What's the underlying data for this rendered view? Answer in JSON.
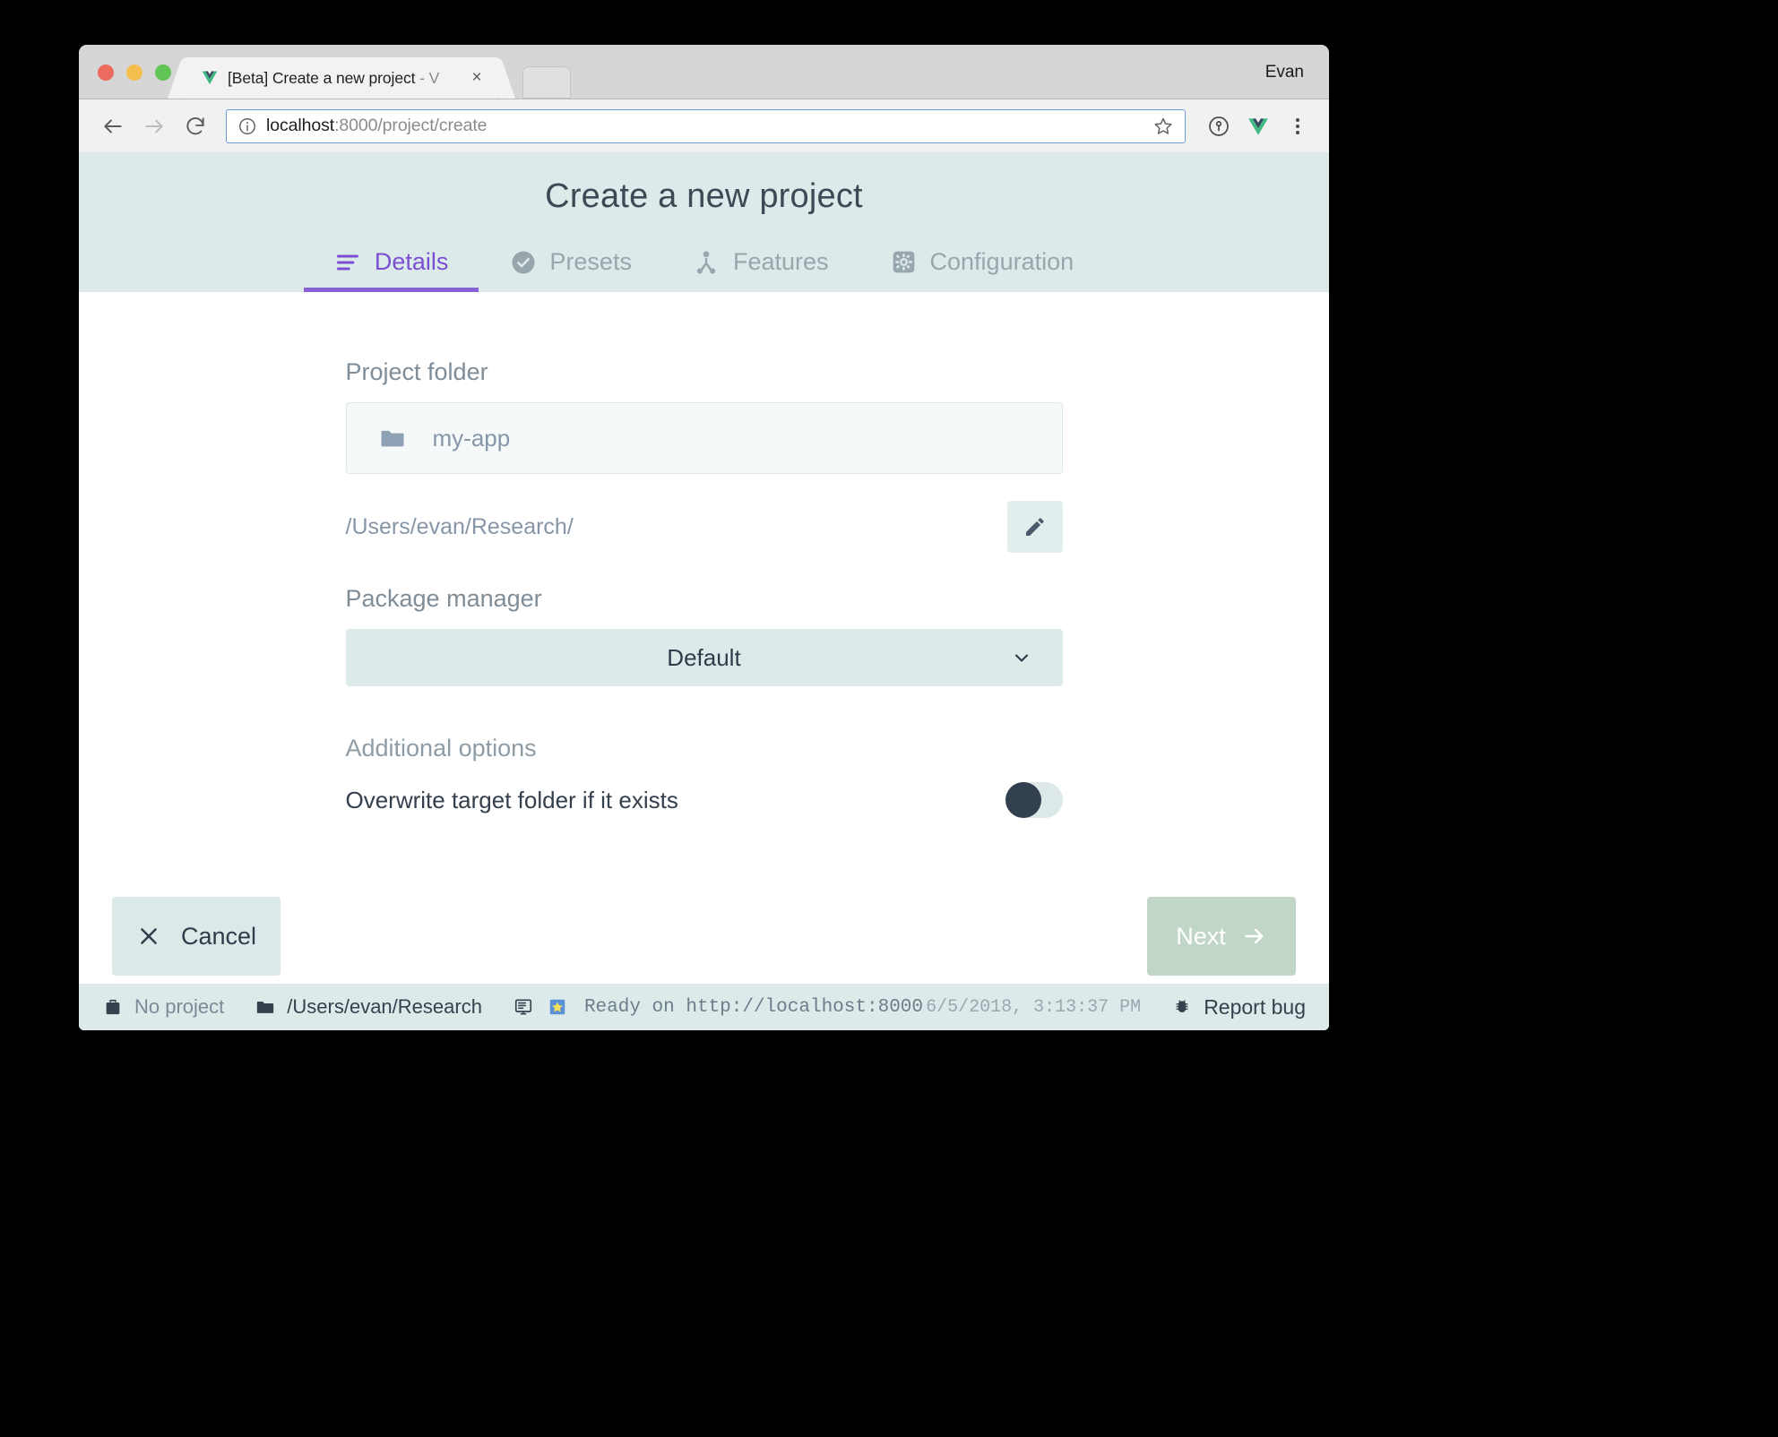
{
  "browser": {
    "tab": {
      "title_main": "[Beta] Create a new project",
      "title_dim": " - V",
      "close_label": "×",
      "favicon_name": "vue-logo-icon"
    },
    "new_tab_label": "",
    "profile_name": "Evan",
    "toolbar": {
      "back_label": "←",
      "forward_label": "→",
      "reload_label": "↻",
      "url_host": "localhost",
      "url_rest": ":8000/project/create",
      "url_full": "localhost:8000/project/create",
      "bookmark_label": "☆",
      "menu_label": "⋮"
    }
  },
  "app": {
    "title": "Create a new project",
    "tabs": [
      {
        "label": "Details",
        "icon": "list-icon",
        "active": true
      },
      {
        "label": "Presets",
        "icon": "check-circle-icon",
        "active": false
      },
      {
        "label": "Features",
        "icon": "sitemap-icon",
        "active": false
      },
      {
        "label": "Configuration",
        "icon": "cog-box-icon",
        "active": false
      }
    ],
    "form": {
      "project_folder_label": "Project folder",
      "project_folder_value": "my-app",
      "project_folder_icon": "folder-icon",
      "path_value": "/Users/evan/Research/",
      "edit_button_icon": "pencil-icon",
      "package_manager_label": "Package manager",
      "package_manager_value": "Default",
      "package_manager_options": [
        "Default"
      ],
      "additional_options_label": "Additional options",
      "overwrite_label": "Overwrite target folder if it exists",
      "overwrite_value": "off"
    },
    "buttons": {
      "cancel_label": "Cancel",
      "cancel_icon": "close-icon",
      "next_label": "Next",
      "next_icon": "arrow-right-icon"
    }
  },
  "statusbar": {
    "project_label": "No project",
    "project_icon": "briefcase-icon",
    "folder_label": "/Users/evan/Research",
    "folder_icon": "folder-icon",
    "console_icon": "console-icon",
    "news_icon": "star-badge-icon",
    "ready_text": "Ready on http://localhost:8000",
    "timestamp": "6/5/2018, 3:13:37 PM",
    "report_bug_label": "Report bug",
    "report_bug_icon": "bug-icon"
  },
  "colors": {
    "accent_purple": "#8862d6",
    "header_bg": "#dcebea",
    "next_btn_bg": "#c2d6c8",
    "cancel_btn_bg": "#dce9e9",
    "toggle_knob": "#33404f"
  }
}
